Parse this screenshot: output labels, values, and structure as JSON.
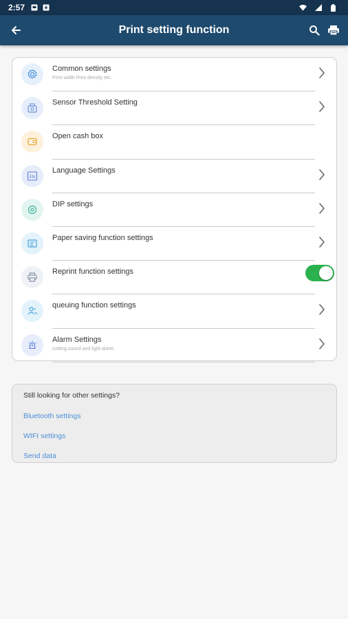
{
  "status_bar": {
    "time": "2:57"
  },
  "app_bar": {
    "title": "Print setting function"
  },
  "settings": [
    {
      "key": "common",
      "label": "Common settings",
      "sub": "Print width Print density etc.",
      "icon": "gear-icon",
      "color": "#4a90d9",
      "bg": "#e6f0fb",
      "control": "chevron"
    },
    {
      "key": "sensor",
      "label": "Sensor Threshold Setting",
      "sub": "",
      "icon": "sensor-icon",
      "color": "#6a8fd9",
      "bg": "#e7eefb",
      "control": "chevron"
    },
    {
      "key": "cashbox",
      "label": "Open cash box",
      "sub": "",
      "icon": "wallet-icon",
      "color": "#e8a93c",
      "bg": "#fdf1dc",
      "control": "none"
    },
    {
      "key": "language",
      "label": "Language Settings",
      "sub": "",
      "icon": "language-icon",
      "color": "#5b7fd6",
      "bg": "#e7ecfa",
      "control": "chevron"
    },
    {
      "key": "dip",
      "label": "DIP settings",
      "sub": "",
      "icon": "dip-icon",
      "color": "#3fb39c",
      "bg": "#e2f5f1",
      "control": "chevron"
    },
    {
      "key": "paper",
      "label": "Paper saving function settings",
      "sub": "",
      "icon": "paper-icon",
      "color": "#4ba3d9",
      "bg": "#e3f2fb",
      "control": "chevron"
    },
    {
      "key": "reprint",
      "label": "Reprint function settings",
      "sub": "",
      "icon": "printer-icon",
      "color": "#7a8aa0",
      "bg": "#eef1f5",
      "control": "toggle",
      "toggle_on": true
    },
    {
      "key": "queue",
      "label": "queuing function settings",
      "sub": "",
      "icon": "users-icon",
      "color": "#4aa9d8",
      "bg": "#e3f3fb",
      "control": "chevron"
    },
    {
      "key": "alarm",
      "label": "Alarm Settings",
      "sub": "cutting,sound and light alarm",
      "icon": "alarm-icon",
      "color": "#5c7fd8",
      "bg": "#e7edfb",
      "control": "chevron"
    }
  ],
  "other": {
    "heading": "Still looking for other settings?",
    "links": [
      "Bluetooth settings",
      "WIFI settings",
      "Send data"
    ]
  },
  "colors": {
    "status_bar": "#15324e",
    "app_bar": "#1e4a6e",
    "link": "#4c8fd8",
    "toggle_on": "#2bb24f"
  }
}
